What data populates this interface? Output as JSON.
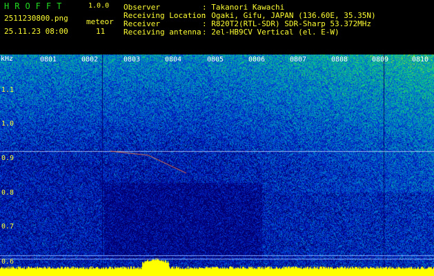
{
  "header": {
    "brand": "HROFFT",
    "version": "1.0.0",
    "filename": "2511230800.png",
    "datetime": "25.11.23 08:00",
    "meteor_label": "meteor",
    "meteor_count": "11",
    "fields": [
      {
        "label": "Observer",
        "value": ": Takanori Kawachi"
      },
      {
        "label": "Receiving Location",
        "value": ": Ogaki, Gifu, JAPAN (136.60E, 35.35N)"
      },
      {
        "label": "Receiver",
        "value": ": R820T2(RTL-SDR) SDR-Sharp 53.372MHz"
      },
      {
        "label": "Receiving antenna",
        "value": ": 2el-HB9CV Vertical (el. E-W)"
      }
    ]
  },
  "plot": {
    "y_unit": "kHz",
    "y_ticks": [
      "1.1",
      "1.0",
      "0.9",
      "0.8",
      "0.7",
      "0.6"
    ],
    "x_ticks": [
      "0801",
      "0802",
      "0803",
      "0804",
      "0805",
      "0806",
      "0807",
      "0808",
      "0809",
      "0810"
    ],
    "colors": {
      "trace": "#ffff00",
      "grid": "#ffffff",
      "label": "#ffff33"
    }
  }
}
